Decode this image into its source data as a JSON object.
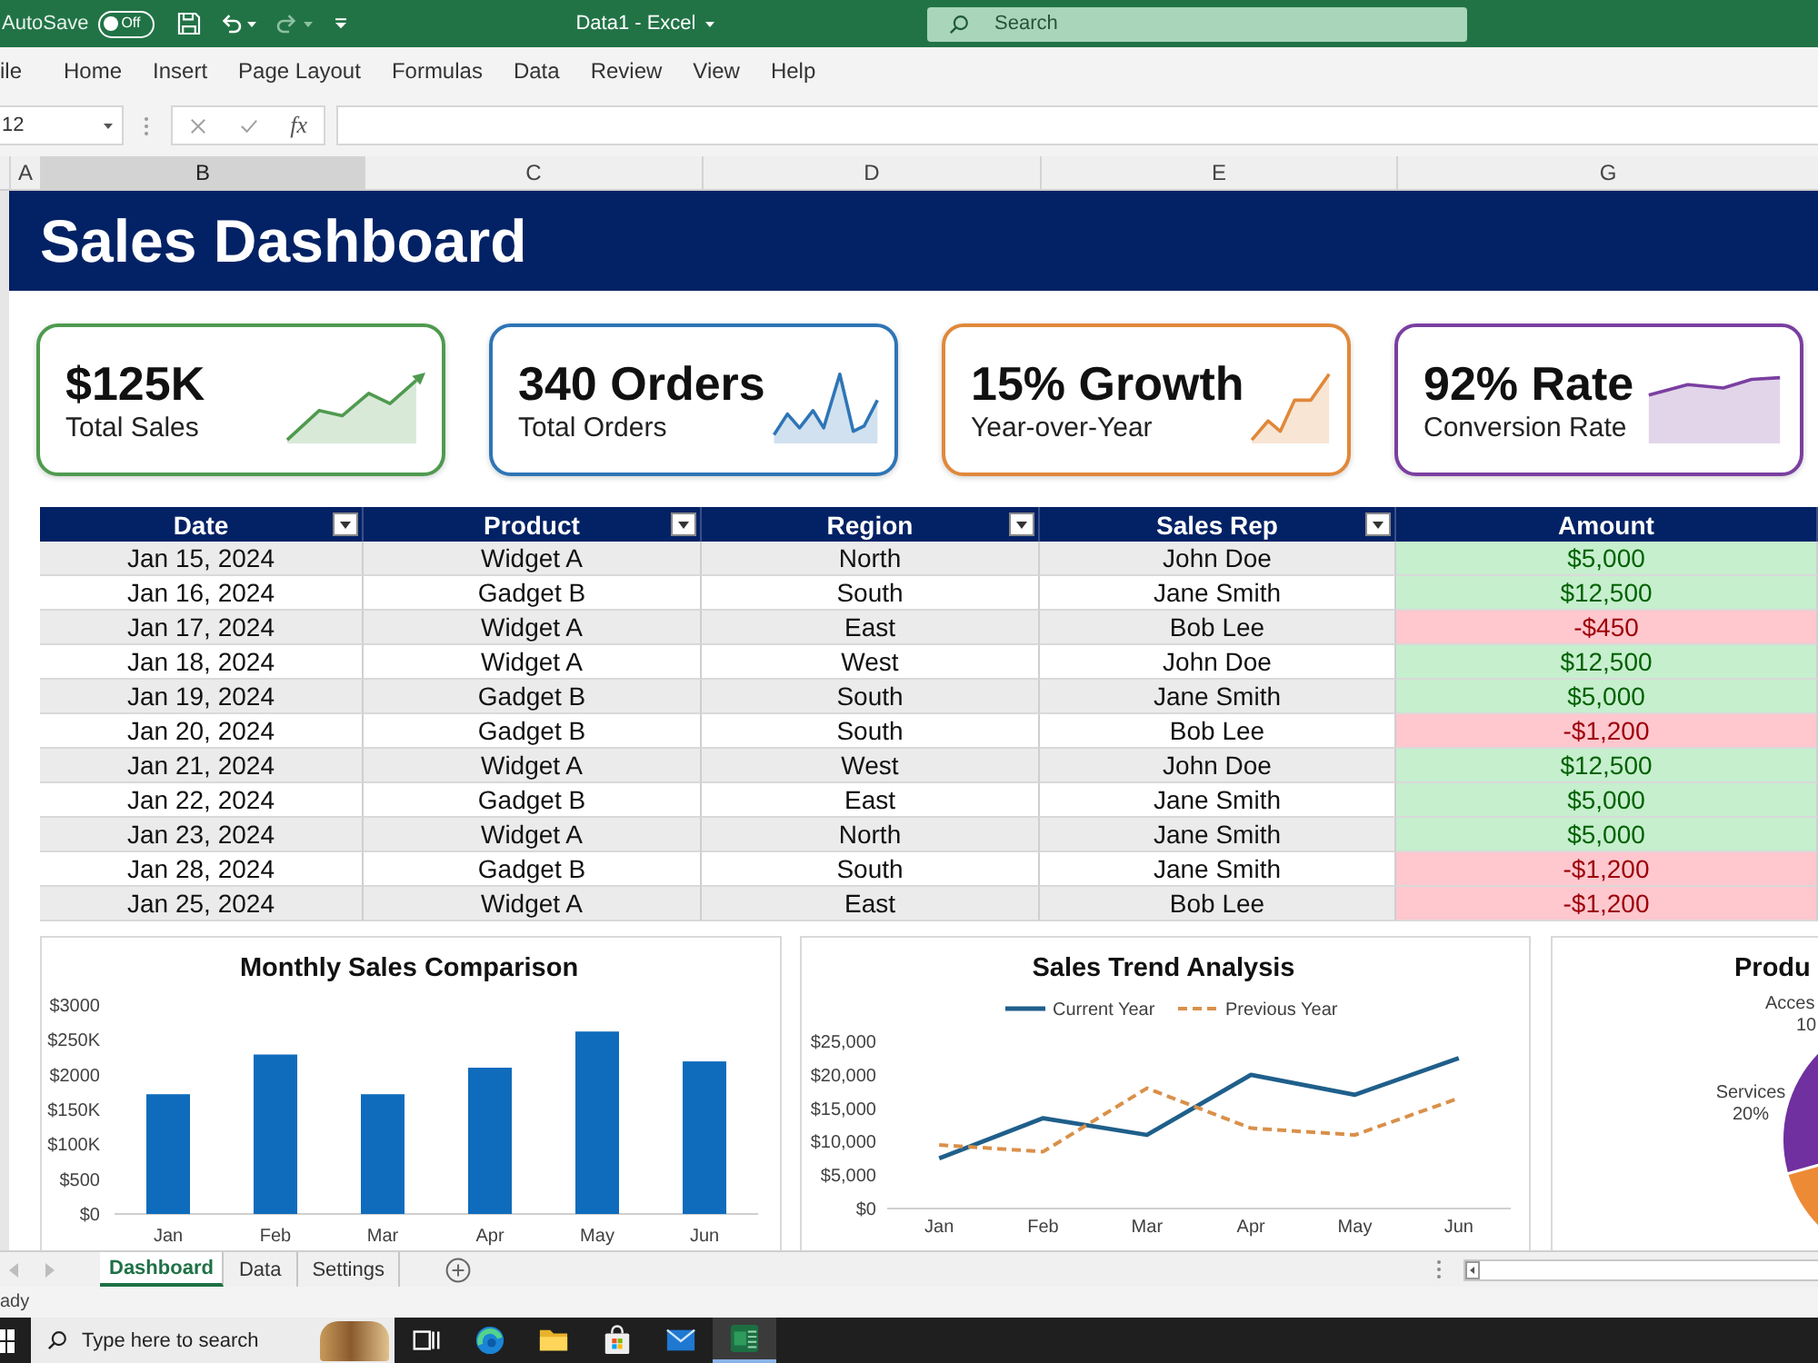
{
  "title_bar": {
    "autosave": {
      "label": "AutoSave",
      "on": false,
      "toggle_text": "Off"
    },
    "quick_access": [
      {
        "kind": "save",
        "disabled": false
      },
      {
        "kind": "undo",
        "disabled": false
      },
      {
        "kind": "redo",
        "disabled": true
      },
      {
        "kind": "customize",
        "disabled": false
      }
    ],
    "document_title": "Data1 - Excel",
    "search": {
      "placeholder": "Search"
    }
  },
  "ribbon_tabs": [
    {
      "label": "ile"
    },
    {
      "label": "Home"
    },
    {
      "label": "Insert"
    },
    {
      "label": "Page Layout"
    },
    {
      "label": "Formulas"
    },
    {
      "label": "Data"
    },
    {
      "label": "Review"
    },
    {
      "label": "View"
    },
    {
      "label": "Help"
    }
  ],
  "formula_bar": {
    "name_box": "12",
    "function_label": "fx"
  },
  "column_headers": [
    {
      "label": "A",
      "selected": false
    },
    {
      "label": "B",
      "selected": true
    },
    {
      "label": "C",
      "selected": false
    },
    {
      "label": "D",
      "selected": false
    },
    {
      "label": "E",
      "selected": false
    },
    {
      "label": "G",
      "selected": false
    }
  ],
  "banner": {
    "title": "Sales Dashboard"
  },
  "kpi_cards": [
    {
      "value": "$125K",
      "label": "Total Sales",
      "color": "#4f9a4f",
      "kind": "arrow"
    },
    {
      "value": "340 Orders",
      "label": "Total Orders",
      "color": "#2e75b6",
      "kind": "zigzag"
    },
    {
      "value": "15% Growth",
      "label": "Year-over-Year",
      "color": "#e0883a",
      "kind": "rising"
    },
    {
      "value": "92% Rate",
      "label": "Conversion Rate",
      "color": "#7a3fa0",
      "kind": "plateau"
    }
  ],
  "table": {
    "columns": [
      {
        "label": "Date",
        "filter": true
      },
      {
        "label": "Product",
        "filter": true
      },
      {
        "label": "Region",
        "filter": true
      },
      {
        "label": "Sales Rep",
        "filter": true
      },
      {
        "label": "Amount",
        "filter": false
      }
    ],
    "rows": [
      {
        "date": "Jan 15, 2024",
        "product": "Widget A",
        "region": "North",
        "rep": "John Doe",
        "amount": "$5,000",
        "loss": false
      },
      {
        "date": "Jan 16, 2024",
        "product": "Gadget B",
        "region": "South",
        "rep": "Jane Smith",
        "amount": "$12,500",
        "loss": false
      },
      {
        "date": "Jan 17, 2024",
        "product": "Widget A",
        "region": "East",
        "rep": "Bob Lee",
        "amount": "-$450",
        "loss": true
      },
      {
        "date": "Jan 18, 2024",
        "product": "Widget A",
        "region": "West",
        "rep": "John Doe",
        "amount": "$12,500",
        "loss": false
      },
      {
        "date": "Jan 19, 2024",
        "product": "Gadget B",
        "region": "South",
        "rep": "Jane Smith",
        "amount": "$5,000",
        "loss": false
      },
      {
        "date": "Jan 20, 2024",
        "product": "Gadget B",
        "region": "South",
        "rep": "Bob Lee",
        "amount": "-$1,200",
        "loss": true
      },
      {
        "date": "Jan 21, 2024",
        "product": "Widget A",
        "region": "West",
        "rep": "John Doe",
        "amount": "$12,500",
        "loss": false
      },
      {
        "date": "Jan 22, 2024",
        "product": "Gadget B",
        "region": "East",
        "rep": "Jane Smith",
        "amount": "$5,000",
        "loss": false
      },
      {
        "date": "Jan 23, 2024",
        "product": "Widget A",
        "region": "North",
        "rep": "Jane Smith",
        "amount": "$5,000",
        "loss": false
      },
      {
        "date": "Jan 28, 2024",
        "product": "Gadget B",
        "region": "South",
        "rep": "Jane Smith",
        "amount": "-$1,200",
        "loss": true
      },
      {
        "date": "Jan 25, 2024",
        "product": "Widget A",
        "region": "East",
        "rep": "Bob Lee",
        "amount": "-$1,200",
        "loss": true
      }
    ]
  },
  "monthly_chart": {
    "title": "Monthly Sales Comparison",
    "y_axis_labels": [
      "$3000",
      "$250K",
      "$2000",
      "$150K",
      "$100K",
      "$500",
      "$0"
    ],
    "categories": [
      "Jan",
      "Feb",
      "Mar",
      "Apr",
      "May",
      "Jun"
    ]
  },
  "trend_chart": {
    "chart_data": {
      "type": "line",
      "title": "Sales Trend Analysis",
      "legend": "top",
      "categories": [
        "Jan",
        "Feb",
        "Mar",
        "Apr",
        "May",
        "Jun"
      ],
      "series": [
        {
          "name": "Current Year",
          "color": "#1f5f8b",
          "line_style": "solid",
          "values": [
            7500,
            13500,
            11000,
            20000,
            17000,
            22500
          ]
        },
        {
          "name": "Previous Year",
          "color": "#d9904a",
          "line_style": "dashed",
          "values": [
            9500,
            8500,
            18000,
            12000,
            11000,
            16500
          ]
        }
      ],
      "ylim": [
        0,
        25000
      ],
      "yticks": [
        {
          "value": 0,
          "label": "$0"
        },
        {
          "value": 5000,
          "label": "$5,000"
        },
        {
          "value": 10000,
          "label": "$10,000"
        },
        {
          "value": 15000,
          "label": "$15,000"
        },
        {
          "value": 20000,
          "label": "$20,000"
        },
        {
          "value": 25000,
          "label": "$25,000"
        }
      ]
    }
  },
  "product_chart": {
    "title": "Produ",
    "labels": [
      {
        "name": "Acces",
        "share": "10"
      },
      {
        "name": "Services",
        "share": "20%"
      }
    ]
  },
  "sheet_tabs": [
    {
      "label": "Dashboard",
      "selected": true
    },
    {
      "label": "Data",
      "selected": false
    },
    {
      "label": "Settings",
      "selected": false
    }
  ],
  "status_bar": {
    "text": "ady"
  },
  "taskbar": {
    "search": {
      "placeholder": "Type here to search"
    },
    "apps": [
      {
        "kind": "task-view",
        "active": false
      },
      {
        "kind": "browser",
        "active": false
      },
      {
        "kind": "folder",
        "active": false
      },
      {
        "kind": "store",
        "active": false
      },
      {
        "kind": "mail",
        "active": false
      },
      {
        "kind": "spreadsheet",
        "active": true
      }
    ]
  }
}
